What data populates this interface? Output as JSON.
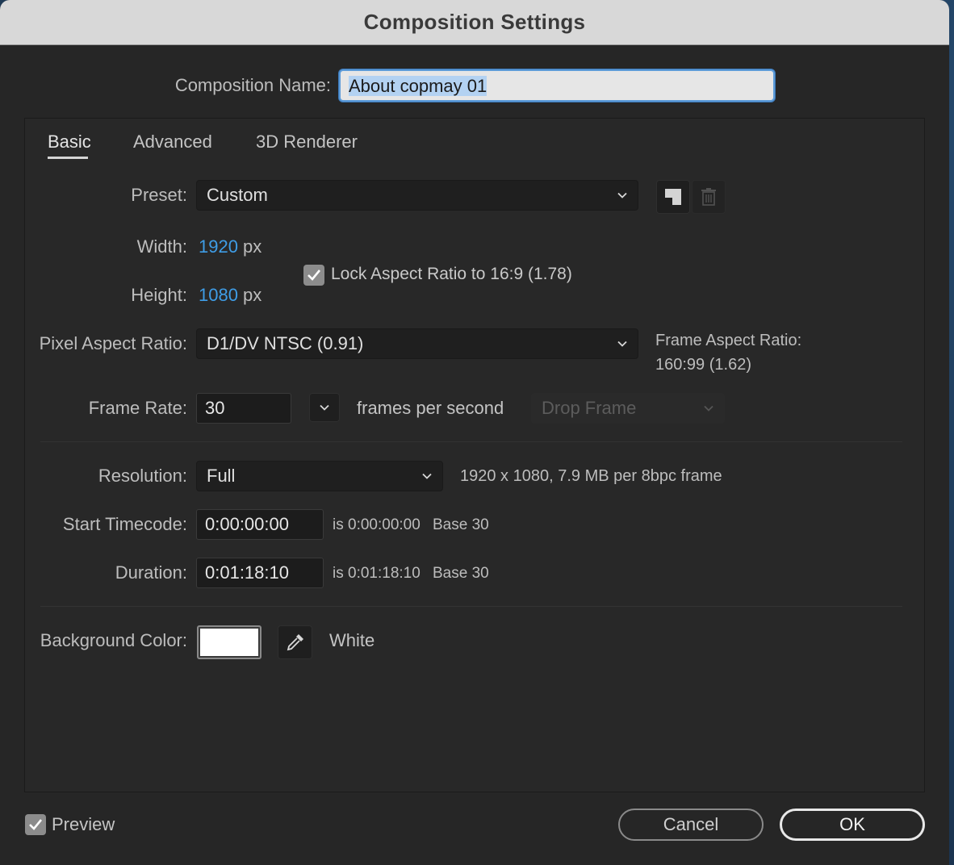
{
  "window": {
    "title": "Composition Settings"
  },
  "composition_name": {
    "label": "Composition Name:",
    "value": "About copmay 01"
  },
  "tabs": [
    {
      "label": "Basic",
      "active": true
    },
    {
      "label": "Advanced",
      "active": false
    },
    {
      "label": "3D Renderer",
      "active": false
    }
  ],
  "preset": {
    "label": "Preset:",
    "value": "Custom",
    "save_icon": "save-preset-icon",
    "delete_icon": "trash-icon"
  },
  "width": {
    "label": "Width:",
    "value": "1920",
    "unit": "px"
  },
  "height": {
    "label": "Height:",
    "value": "1080",
    "unit": "px"
  },
  "lock_aspect": {
    "label": "Lock Aspect Ratio to 16:9 (1.78)",
    "checked": true
  },
  "pixel_aspect": {
    "label": "Pixel Aspect Ratio:",
    "value": "D1/DV NTSC (0.91)"
  },
  "frame_aspect": {
    "label": "Frame Aspect Ratio:",
    "value": "160:99 (1.62)"
  },
  "frame_rate": {
    "label": "Frame Rate:",
    "value": "30",
    "unit": "frames per second",
    "drop_frame": "Drop Frame"
  },
  "resolution": {
    "label": "Resolution:",
    "value": "Full",
    "info": "1920 x 1080, 7.9 MB per 8bpc frame"
  },
  "start_timecode": {
    "label": "Start Timecode:",
    "value": "0:00:00:00",
    "is_text": "is 0:00:00:00",
    "base": "Base 30"
  },
  "duration": {
    "label": "Duration:",
    "value": "0:01:18:10",
    "is_text": "is 0:01:18:10",
    "base": "Base 30"
  },
  "background": {
    "label": "Background Color:",
    "color": "#ffffff",
    "name": "White",
    "eyedropper_icon": "eyedropper-icon"
  },
  "footer": {
    "preview_label": "Preview",
    "preview_checked": true,
    "cancel": "Cancel",
    "ok": "OK"
  },
  "colors": {
    "accent_blue": "#3f9de6",
    "dialog_bg": "#262626",
    "title_bar": "#d8d8d8"
  }
}
